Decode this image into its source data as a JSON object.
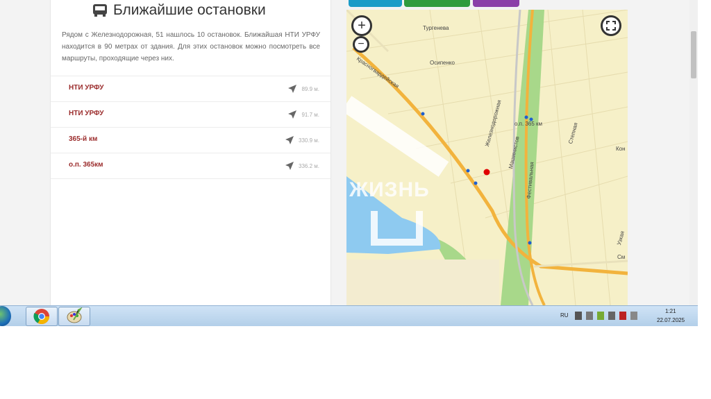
{
  "stops": {
    "title": "Ближайшие остановки",
    "description": "Рядом с Железнодорожная, 51 нашлось 10 остановок. Ближайшая НТИ УРФУ находится в 90 метрах от здания. Для этих остановок можно посмотреть все маршруты, проходящие через них.",
    "items": [
      {
        "name": "НТИ УРФУ",
        "distance": "89.9 м."
      },
      {
        "name": "НТИ УРФУ",
        "distance": "91.7 м."
      },
      {
        "name": "365-й км",
        "distance": "330.9 м."
      },
      {
        "name": "о.п. 365км",
        "distance": "336.2 м."
      }
    ]
  },
  "map": {
    "labels": {
      "turgeneva": "Тургенева",
      "osipenko": "Осипенко",
      "krasnogvardeyskaya": "Красногвардейская",
      "zheleznodorozhnaya": "Железнодорожная",
      "mashinistov": "Машинистов",
      "festivalnaya": "Фестивальная",
      "stepnaya": "Степная",
      "op365": "о.п. 365 км",
      "kon": "Кон",
      "uzk": "Узкая",
      "sm": "См"
    },
    "watermark": "ЖИЗНЬ",
    "zoom_in": "+",
    "zoom_out": "−",
    "colors": {
      "road": "#f2b33d",
      "water": "#8ecaf0",
      "park": "#a8d88a",
      "marker": "#e00000"
    }
  },
  "taskbar": {
    "lang": "RU",
    "time": "1:21",
    "date": "22.07.2025"
  }
}
